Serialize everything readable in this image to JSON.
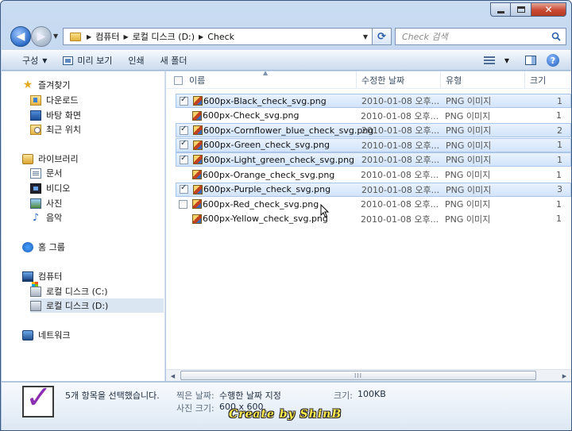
{
  "window": {
    "close_glyph": "✕"
  },
  "address": {
    "breadcrumb": [
      "컴퓨터",
      "로컬 디스크 (D:)",
      "Check"
    ],
    "search_placeholder": "Check 검색"
  },
  "toolbar": {
    "organize": "구성",
    "preview": "미리 보기",
    "print": "인쇄",
    "new_folder": "새 폴더",
    "help": "?"
  },
  "nav": {
    "favorites": "즐겨찾기",
    "downloads": "다운로드",
    "desktop": "바탕 화면",
    "recent": "최근 위치",
    "libraries": "라이브러리",
    "documents": "문서",
    "videos": "비디오",
    "pictures": "사진",
    "music": "음악",
    "homegroup": "홈 그룹",
    "computer": "컴퓨터",
    "drive_c": "로컬 디스크 (C:)",
    "drive_d": "로컬 디스크 (D:)",
    "network": "네트워크"
  },
  "columns": {
    "name": "이름",
    "date": "수정한 날짜",
    "type": "유형",
    "size": "크기"
  },
  "files": [
    {
      "name": "600px-Black_check_svg.png",
      "date": "2010-01-08 오후...",
      "type": "PNG 이미지",
      "size": "1",
      "checked": true,
      "selected": true
    },
    {
      "name": "600px-Check_svg.png",
      "date": "2010-01-08 오후...",
      "type": "PNG 이미지",
      "size": "1",
      "checked": false,
      "selected": false
    },
    {
      "name": "600px-Cornflower_blue_check_svg.png",
      "date": "2010-01-08 오후...",
      "type": "PNG 이미지",
      "size": "2",
      "checked": true,
      "selected": true
    },
    {
      "name": "600px-Green_check_svg.png",
      "date": "2010-01-08 오후...",
      "type": "PNG 이미지",
      "size": "1",
      "checked": true,
      "selected": true
    },
    {
      "name": "600px-Light_green_check_svg.png",
      "date": "2010-01-08 오후...",
      "type": "PNG 이미지",
      "size": "1",
      "checked": true,
      "selected": true
    },
    {
      "name": "600px-Orange_check_svg.png",
      "date": "2010-01-08 오후...",
      "type": "PNG 이미지",
      "size": "1",
      "checked": false,
      "selected": false
    },
    {
      "name": "600px-Purple_check_svg.png",
      "date": "2010-01-08 오후...",
      "type": "PNG 이미지",
      "size": "3",
      "checked": true,
      "selected": true
    },
    {
      "name": "600px-Red_check_svg.png",
      "date": "2010-01-08 오후...",
      "type": "PNG 이미지",
      "size": "1",
      "checked": false,
      "selected": false,
      "hover_checkbox": true
    },
    {
      "name": "600px-Yellow_check_svg.png",
      "date": "2010-01-08 오후...",
      "type": "PNG 이미지",
      "size": "1",
      "checked": false,
      "selected": false
    }
  ],
  "scrollbar": {
    "grip": "III"
  },
  "details": {
    "selection": "5개 항목을 선택했습니다.",
    "date_taken_label": "찍은 날짜:",
    "date_taken_value": "수행한 날짜 지정",
    "size_label": "크기:",
    "size_value": "100KB",
    "dimensions_label": "사진 크기:",
    "dimensions_value": "600 x 600",
    "big_check": "✓"
  },
  "watermark": "Create by ShinB"
}
